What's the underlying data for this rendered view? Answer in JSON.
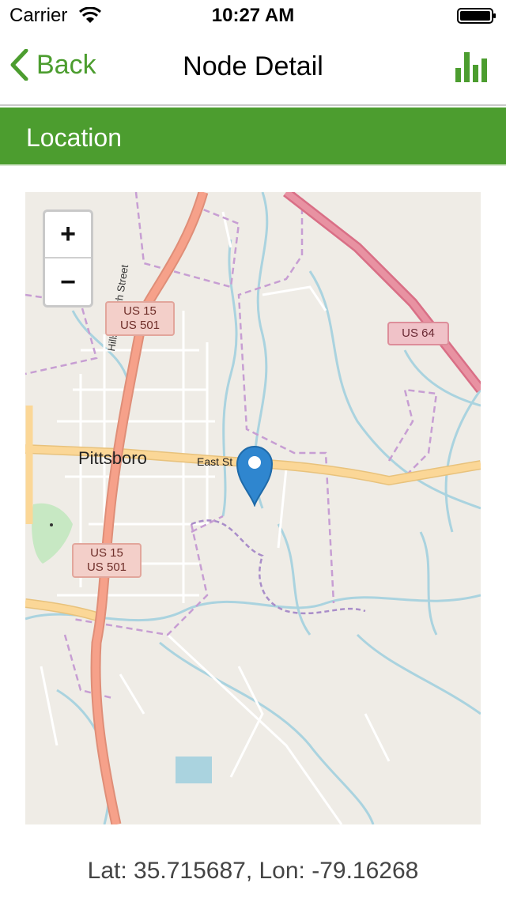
{
  "status_bar": {
    "carrier": "Carrier",
    "time": "10:27 AM",
    "wifi_icon": "wifi-icon",
    "battery_icon": "battery-icon"
  },
  "nav_bar": {
    "back_label": "Back",
    "title": "Node Detail",
    "stats_icon": "bar-chart-icon",
    "accent_color": "#4c9d2f"
  },
  "section": {
    "title": "Location",
    "background_color": "#4c9d2f"
  },
  "map": {
    "zoom_in_label": "+",
    "zoom_out_label": "−",
    "town_label": "Pittsboro",
    "street_label": "East St",
    "highway_label": "Hillsborough Street",
    "shield_a_line1": "US 15",
    "shield_a_line2": "US 501",
    "shield_b_line1": "US 15",
    "shield_b_line2": "US 501",
    "shield_c": "US 64",
    "marker_icon": "map-pin-icon",
    "marker_color": "#2f86cf"
  },
  "location": {
    "latitude": 35.715687,
    "longitude": -79.16268,
    "text": "Lat: 35.715687, Lon: -79.16268"
  }
}
